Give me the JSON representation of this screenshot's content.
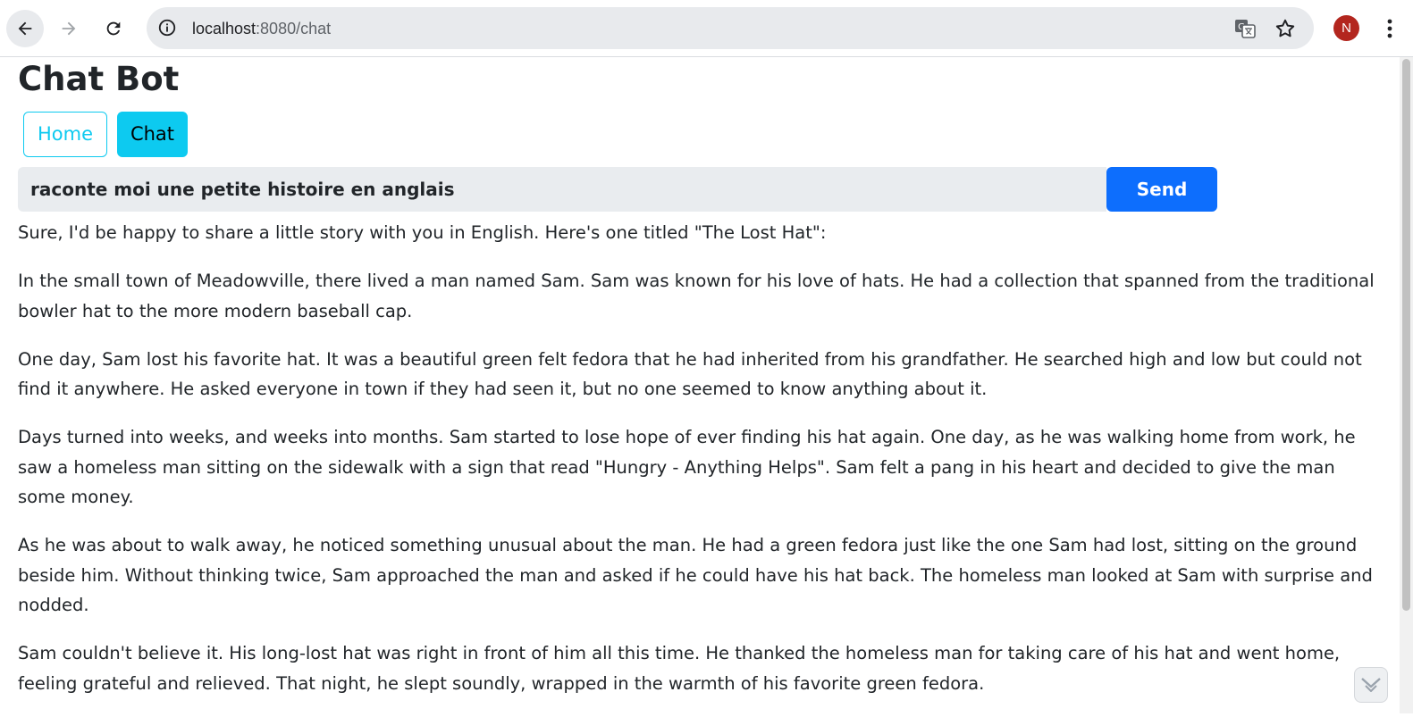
{
  "browser": {
    "url_host": "localhost",
    "url_rest": ":8080/chat",
    "profile_initial": "N"
  },
  "page": {
    "title": "Chat Bot",
    "tabs": [
      {
        "label": "Home"
      },
      {
        "label": "Chat"
      }
    ]
  },
  "chat": {
    "input_value": "raconte moi une petite histoire en anglais",
    "send_label": "Send",
    "response": [
      "Sure, I'd be happy to share a little story with you in English. Here's one titled \"The Lost Hat\":",
      "In the small town of Meadowville, there lived a man named Sam. Sam was known for his love of hats. He had a collection that spanned from the traditional bowler hat to the more modern baseball cap.",
      "One day, Sam lost his favorite hat. It was a beautiful green felt fedora that he had inherited from his grandfather. He searched high and low but could not find it anywhere. He asked everyone in town if they had seen it, but no one seemed to know anything about it.",
      "Days turned into weeks, and weeks into months. Sam started to lose hope of ever finding his hat again. One day, as he was walking home from work, he saw a homeless man sitting on the sidewalk with a sign that read \"Hungry - Anything Helps\". Sam felt a pang in his heart and decided to give the man some money.",
      "As he was about to walk away, he noticed something unusual about the man. He had a green fedora just like the one Sam had lost, sitting on the ground beside him. Without thinking twice, Sam approached the man and asked if he could have his hat back. The homeless man looked at Sam with surprise and nodded.",
      "Sam couldn't believe it. His long-lost hat was right in front of him all this time. He thanked the homeless man for taking care of his hat and went home, feeling grateful and relieved. That night, he slept soundly, wrapped in the warmth of his favorite green fedora."
    ]
  },
  "colors": {
    "accent_info": "#0dcaf0",
    "primary": "#0d6efd",
    "avatar": "#b3261e"
  },
  "icons": [
    "back-arrow-icon",
    "forward-arrow-icon",
    "reload-icon",
    "info-icon",
    "translate-icon",
    "star-icon",
    "kebab-menu-icon",
    "chevron-down-icon"
  ]
}
